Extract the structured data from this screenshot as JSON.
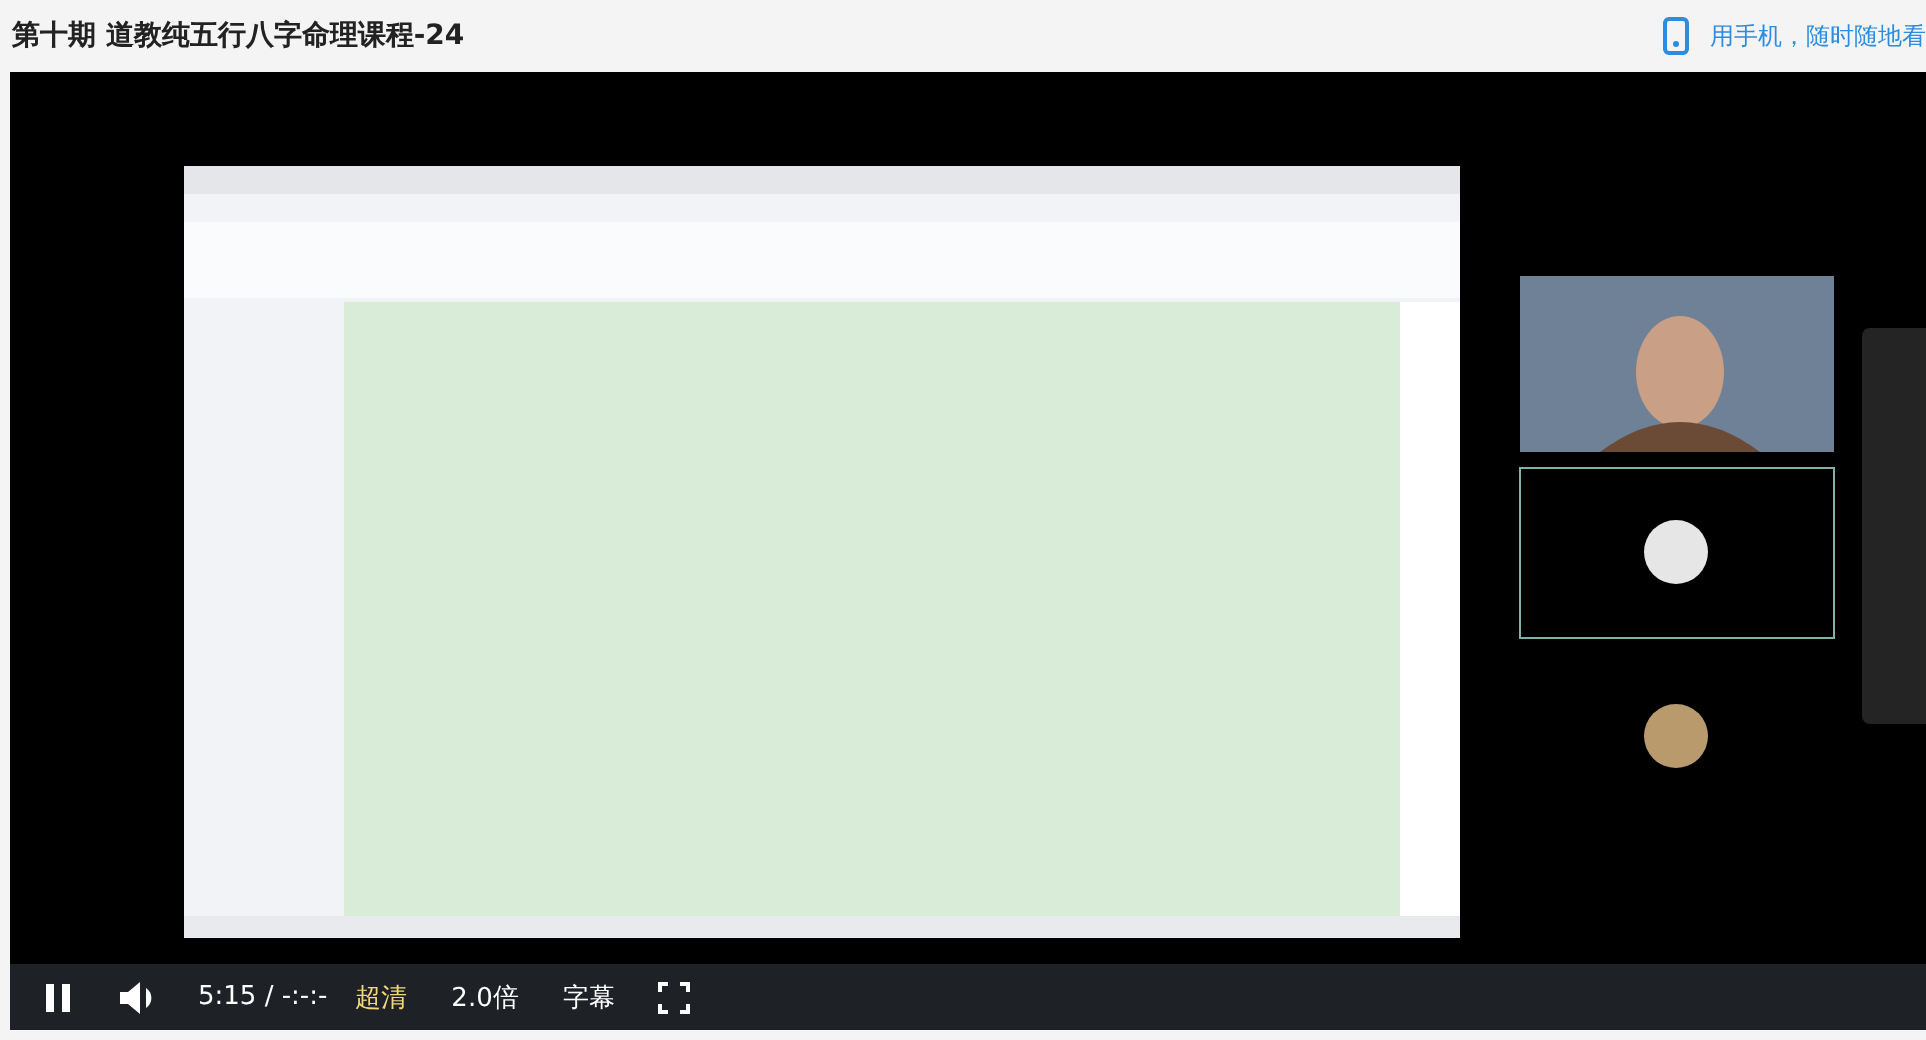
{
  "title": "第十期 道教纯五行八字命理课程-24",
  "mobile_link": {
    "label": "用手机，随时随地看"
  },
  "player": {
    "playing": true,
    "time": "5:15 / -:-:-",
    "quality": "超清",
    "speed": "2.0倍",
    "subtitles": "字幕"
  }
}
